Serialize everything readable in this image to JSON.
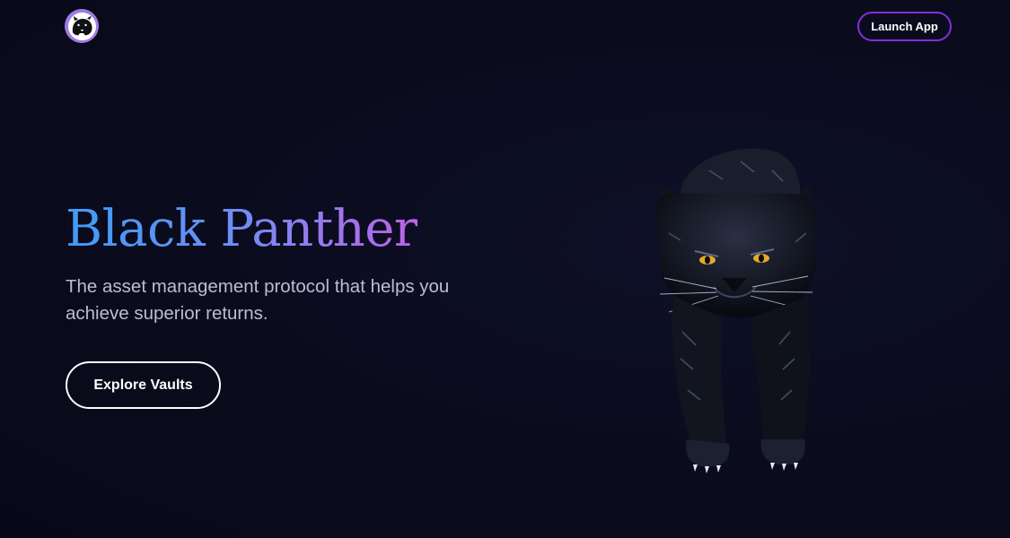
{
  "header": {
    "logo_icon": "panther-head-icon",
    "launch_label": "Launch App"
  },
  "hero": {
    "title": "Black Panther",
    "subtitle": "The asset management protocol that helps you achieve superior returns.",
    "explore_label": "Explore Vaults",
    "illustration": "panther-illustration"
  },
  "colors": {
    "background": "#0a0b1c",
    "accent_border": "#8a2be2",
    "logo_ring": "#a27ae6",
    "title_gradient_start": "#3f9cf5",
    "title_gradient_end": "#bb63e6",
    "subtitle_text": "#b9bfcf",
    "panther_eyes": "#e5a92b"
  }
}
